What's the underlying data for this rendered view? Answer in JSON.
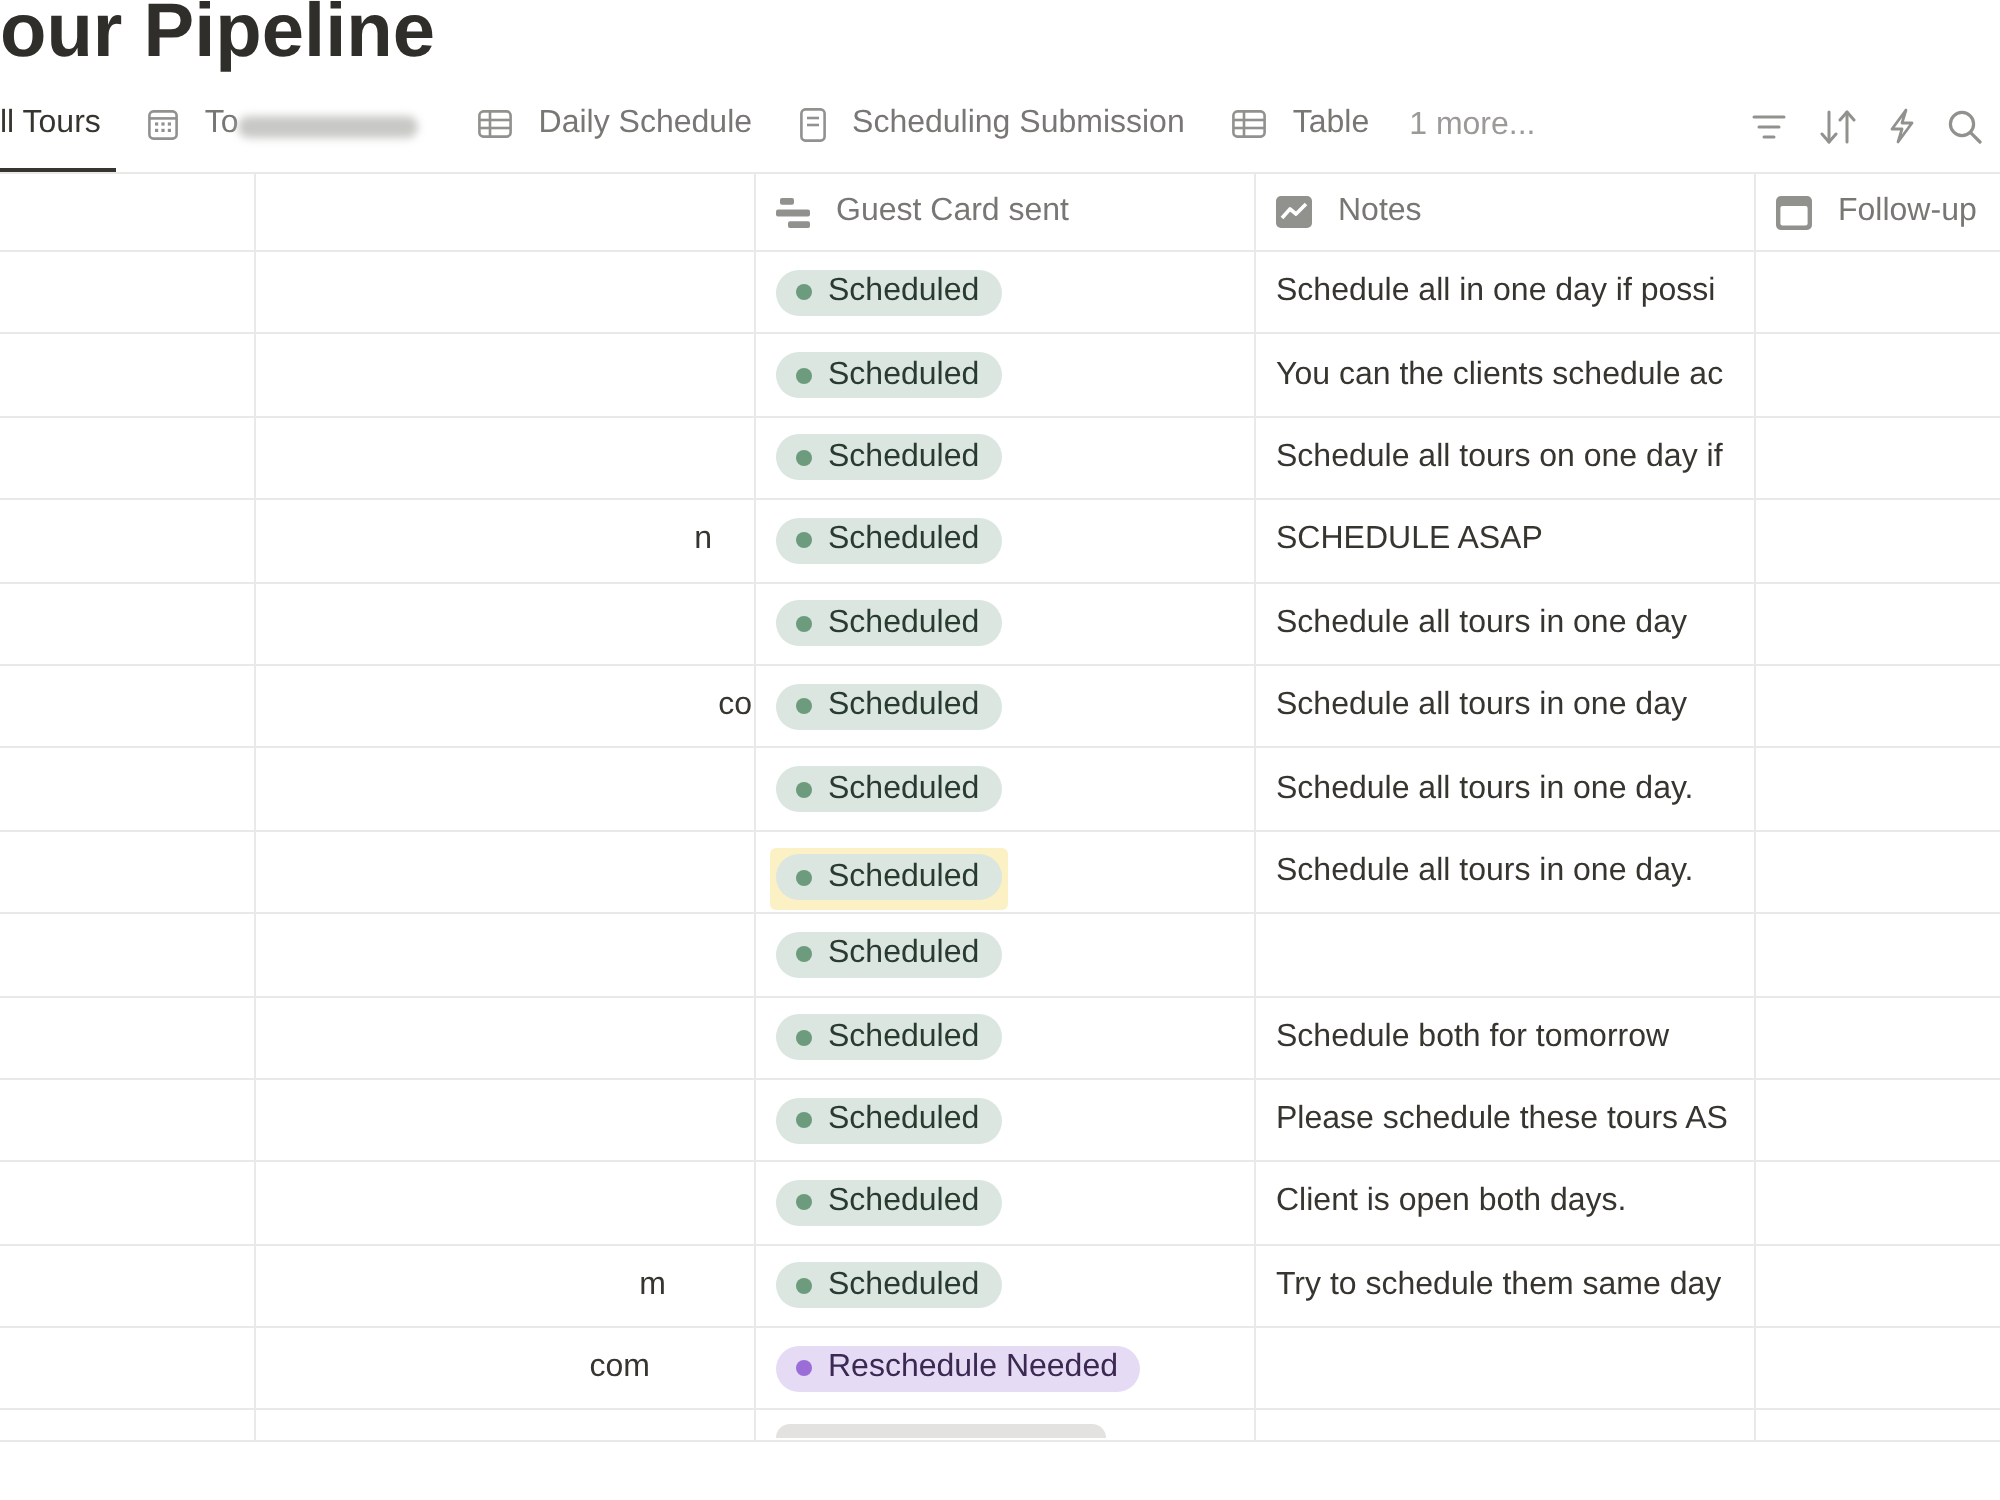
{
  "page": {
    "title": "our Pipeline"
  },
  "views": {
    "tabs": [
      {
        "label": "ll Tours",
        "kind": "plain",
        "selected": true,
        "redacted": false
      },
      {
        "label": "To",
        "kind": "calendar",
        "selected": false,
        "redacted": true
      },
      {
        "label": "Daily Schedule",
        "kind": "table",
        "selected": false,
        "redacted": false
      },
      {
        "label": "Scheduling Submission",
        "kind": "form",
        "selected": false,
        "redacted": false
      },
      {
        "label": "Table",
        "kind": "table",
        "selected": false,
        "redacted": false
      }
    ],
    "more": "1 more..."
  },
  "table": {
    "columns": [
      {
        "label": "Guest Card sent",
        "kind": "status"
      },
      {
        "label": "Notes",
        "kind": "text"
      },
      {
        "label": "Follow-up",
        "kind": "date"
      }
    ],
    "rows": [
      {
        "status": {
          "label": "Scheduled",
          "color": "#6c9b7d",
          "highlighted": false
        },
        "notes": "Schedule all in one day if possi"
      },
      {
        "status": {
          "label": "Scheduled",
          "color": "#6c9b7d",
          "highlighted": false
        },
        "notes": "You can the clients schedule ac"
      },
      {
        "status": {
          "label": "Scheduled",
          "color": "#6c9b7d",
          "highlighted": false
        },
        "notes": "Schedule all tours on one day if"
      },
      {
        "column_2": "n",
        "status": {
          "label": "Scheduled",
          "color": "#6c9b7d",
          "highlighted": false
        },
        "notes": "SCHEDULE ASAP"
      },
      {
        "status": {
          "label": "Scheduled",
          "color": "#6c9b7d",
          "highlighted": false
        },
        "notes": "Schedule all tours in one day"
      },
      {
        "column_2": "co",
        "status": {
          "label": "Scheduled",
          "color": "#6c9b7d",
          "highlighted": false
        },
        "notes": "Schedule all tours in one day"
      },
      {
        "status": {
          "label": "Scheduled",
          "color": "#6c9b7d",
          "highlighted": false
        },
        "notes": "Schedule all tours in one day."
      },
      {
        "status": {
          "label": "Scheduled",
          "color": "#6c9b7d",
          "highlighted": true
        },
        "notes": "Schedule all tours in one day."
      },
      {
        "status": {
          "label": "Scheduled",
          "color": "#6c9b7d",
          "highlighted": false
        }
      },
      {
        "status": {
          "label": "Scheduled",
          "color": "#6c9b7d",
          "highlighted": false
        },
        "notes": "Schedule both for tomorrow"
      },
      {
        "status": {
          "label": "Scheduled",
          "color": "#6c9b7d",
          "highlighted": false
        },
        "notes": "Please schedule these tours AS"
      },
      {
        "status": {
          "label": "Scheduled",
          "color": "#6c9b7d",
          "highlighted": false
        },
        "notes": "Client is open both days."
      },
      {
        "column_2": "m",
        "status": {
          "label": "Scheduled",
          "color": "#6c9b7d",
          "highlighted": false
        },
        "notes": "Try to schedule them same day"
      },
      {
        "column_2": "com",
        "status": {
          "label": "Reschedule Needed",
          "color": "#9a6dd7",
          "highlighted": false
        }
      },
      {
        "status": {
          "color": "#e3e2e0"
        }
      }
    ]
  }
}
